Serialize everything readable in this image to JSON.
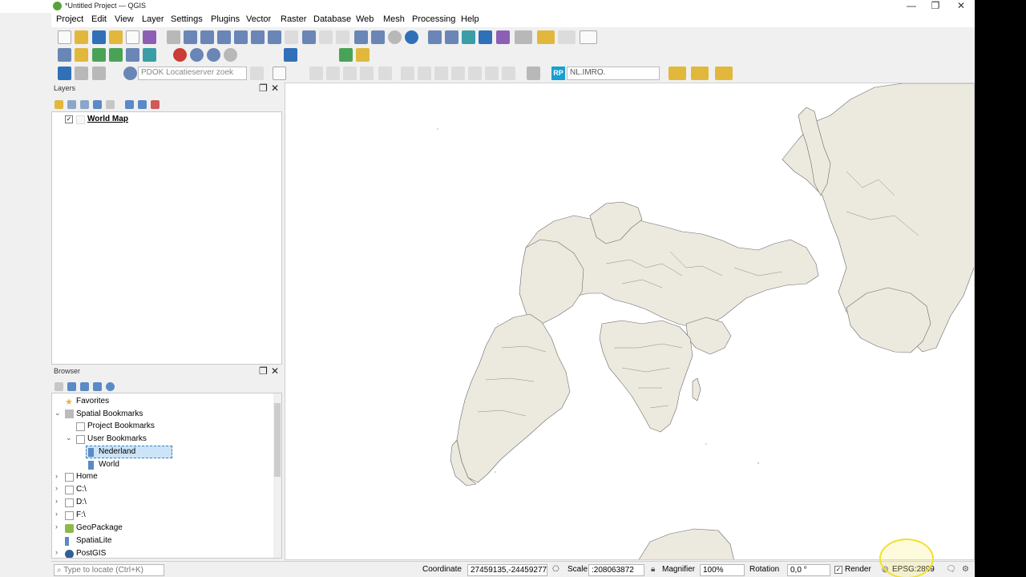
{
  "window": {
    "title": "*Untitled Project — QGIS",
    "minimize": "—",
    "restore": "❐",
    "close": "✕"
  },
  "menu": [
    "Project",
    "Edit",
    "View",
    "Layer",
    "Settings",
    "Plugins",
    "Vector",
    "Raster",
    "Database",
    "Web",
    "Mesh",
    "Processing",
    "Help"
  ],
  "toolbar3": {
    "pdok_placeholder": "PDOK Locatieserver zoek",
    "rp_badge": "RP",
    "nlimro_value": "NL.IMRO."
  },
  "layers_panel": {
    "title": "Layers",
    "items": [
      {
        "label": "World Map",
        "checked": true
      }
    ]
  },
  "browser_panel": {
    "title": "Browser",
    "items": [
      {
        "label": "Favorites",
        "icon": "star-icon"
      },
      {
        "label": "Spatial Bookmarks",
        "icon": "bookmarks-icon",
        "expanded": true
      },
      {
        "label": "Project Bookmarks",
        "icon": "folder-icon"
      },
      {
        "label": "User Bookmarks",
        "icon": "folder-icon",
        "expanded": true
      },
      {
        "label": "Nederland",
        "icon": "bookmark-icon",
        "selected": true
      },
      {
        "label": "World",
        "icon": "bookmark-icon"
      },
      {
        "label": "Home",
        "icon": "home-icon"
      },
      {
        "label": "C:\\",
        "icon": "drive-icon"
      },
      {
        "label": "D:\\",
        "icon": "drive-icon"
      },
      {
        "label": "F:\\",
        "icon": "drive-icon"
      },
      {
        "label": "GeoPackage",
        "icon": "geopackage-icon"
      },
      {
        "label": "SpatiaLite",
        "icon": "spatialite-icon"
      },
      {
        "label": "PostGIS",
        "icon": "postgis-icon"
      }
    ]
  },
  "statusbar": {
    "locate_placeholder": "Type to locate (Ctrl+K)",
    "coordinate_label": "Coordinate",
    "coordinate_value": "27459135,-24459277",
    "scale_label": "Scale",
    "scale_value": ":208063872",
    "magnifier_label": "Magnifier",
    "magnifier_value": "100%",
    "rotation_label": "Rotation",
    "rotation_value": "0,0 °",
    "render_label": "Render",
    "render_checked": true,
    "crs_value": "EPSG:2899"
  },
  "colors": {
    "land": "#ece9df",
    "border": "#6b6b6b",
    "ocean": "#ffffff",
    "highlight": "#f2e02c"
  }
}
